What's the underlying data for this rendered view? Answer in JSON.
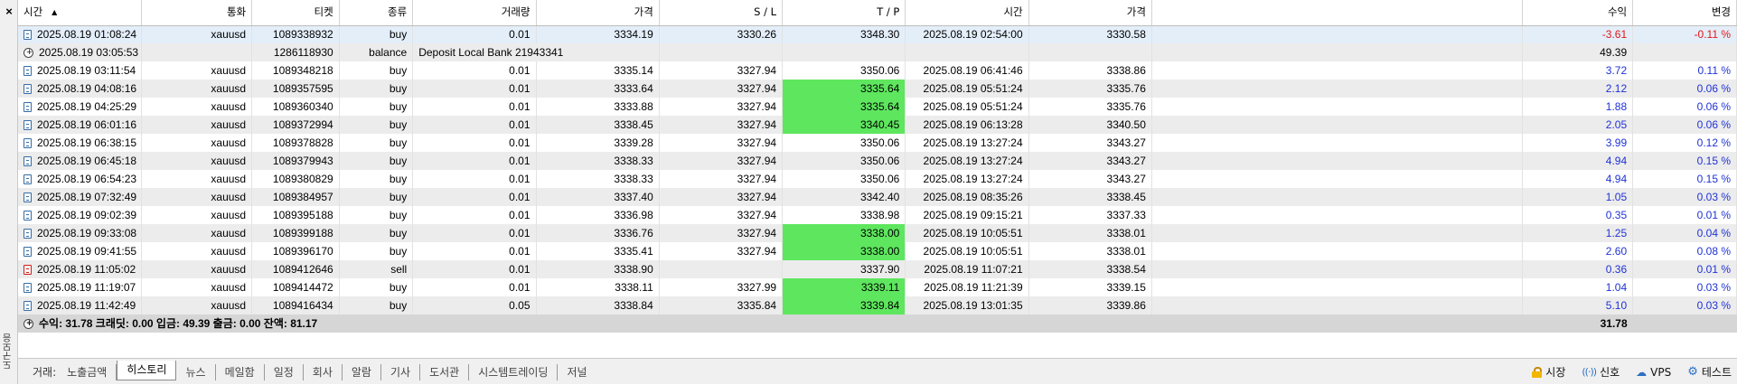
{
  "window": {
    "close_glyph": "×",
    "side_label": "도구모음"
  },
  "columns": [
    "시간",
    "통화",
    "티켓",
    "종류",
    "거래량",
    "가격",
    "S / L",
    "T / P",
    "시간",
    "가격",
    "",
    "수익",
    "변경"
  ],
  "rows": [
    {
      "icon": "buy-order-icon",
      "open_time": "2025.08.19 01:08:24",
      "symbol": "xauusd",
      "ticket": "1089338932",
      "type": "buy",
      "volume": "0.01",
      "price": "3334.19",
      "sl": "3330.26",
      "tp": "3348.30",
      "tp_hit": false,
      "close_time": "2025.08.19 02:54:00",
      "close_price": "3330.58",
      "comment": "",
      "profit": "-3.61",
      "change": "-0.11 %",
      "sign": "neg",
      "selected": true
    },
    {
      "icon": "deposit-icon",
      "open_time": "2025.08.19 03:05:53",
      "symbol": "",
      "ticket": "1286118930",
      "type": "balance",
      "volume": "Deposit Local Bank 21943341",
      "price": "",
      "sl": "",
      "tp": "",
      "tp_hit": false,
      "close_time": "",
      "close_price": "",
      "comment": "",
      "profit": "49.39",
      "change": "",
      "sign": "none",
      "selected": false
    },
    {
      "icon": "buy-order-icon",
      "open_time": "2025.08.19 03:11:54",
      "symbol": "xauusd",
      "ticket": "1089348218",
      "type": "buy",
      "volume": "0.01",
      "price": "3335.14",
      "sl": "3327.94",
      "tp": "3350.06",
      "tp_hit": false,
      "close_time": "2025.08.19 06:41:46",
      "close_price": "3338.86",
      "comment": "",
      "profit": "3.72",
      "change": "0.11 %",
      "sign": "pos",
      "selected": false
    },
    {
      "icon": "buy-order-icon",
      "open_time": "2025.08.19 04:08:16",
      "symbol": "xauusd",
      "ticket": "1089357595",
      "type": "buy",
      "volume": "0.01",
      "price": "3333.64",
      "sl": "3327.94",
      "tp": "3335.64",
      "tp_hit": true,
      "close_time": "2025.08.19 05:51:24",
      "close_price": "3335.76",
      "comment": "",
      "profit": "2.12",
      "change": "0.06 %",
      "sign": "pos",
      "selected": false
    },
    {
      "icon": "buy-order-icon",
      "open_time": "2025.08.19 04:25:29",
      "symbol": "xauusd",
      "ticket": "1089360340",
      "type": "buy",
      "volume": "0.01",
      "price": "3333.88",
      "sl": "3327.94",
      "tp": "3335.64",
      "tp_hit": true,
      "close_time": "2025.08.19 05:51:24",
      "close_price": "3335.76",
      "comment": "",
      "profit": "1.88",
      "change": "0.06 %",
      "sign": "pos",
      "selected": false
    },
    {
      "icon": "buy-order-icon",
      "open_time": "2025.08.19 06:01:16",
      "symbol": "xauusd",
      "ticket": "1089372994",
      "type": "buy",
      "volume": "0.01",
      "price": "3338.45",
      "sl": "3327.94",
      "tp": "3340.45",
      "tp_hit": true,
      "close_time": "2025.08.19 06:13:28",
      "close_price": "3340.50",
      "comment": "",
      "profit": "2.05",
      "change": "0.06 %",
      "sign": "pos",
      "selected": false
    },
    {
      "icon": "buy-order-icon",
      "open_time": "2025.08.19 06:38:15",
      "symbol": "xauusd",
      "ticket": "1089378828",
      "type": "buy",
      "volume": "0.01",
      "price": "3339.28",
      "sl": "3327.94",
      "tp": "3350.06",
      "tp_hit": false,
      "close_time": "2025.08.19 13:27:24",
      "close_price": "3343.27",
      "comment": "",
      "profit": "3.99",
      "change": "0.12 %",
      "sign": "pos",
      "selected": false
    },
    {
      "icon": "buy-order-icon",
      "open_time": "2025.08.19 06:45:18",
      "symbol": "xauusd",
      "ticket": "1089379943",
      "type": "buy",
      "volume": "0.01",
      "price": "3338.33",
      "sl": "3327.94",
      "tp": "3350.06",
      "tp_hit": false,
      "close_time": "2025.08.19 13:27:24",
      "close_price": "3343.27",
      "comment": "",
      "profit": "4.94",
      "change": "0.15 %",
      "sign": "pos",
      "selected": false
    },
    {
      "icon": "buy-order-icon",
      "open_time": "2025.08.19 06:54:23",
      "symbol": "xauusd",
      "ticket": "1089380829",
      "type": "buy",
      "volume": "0.01",
      "price": "3338.33",
      "sl": "3327.94",
      "tp": "3350.06",
      "tp_hit": false,
      "close_time": "2025.08.19 13:27:24",
      "close_price": "3343.27",
      "comment": "",
      "profit": "4.94",
      "change": "0.15 %",
      "sign": "pos",
      "selected": false
    },
    {
      "icon": "buy-order-icon",
      "open_time": "2025.08.19 07:32:49",
      "symbol": "xauusd",
      "ticket": "1089384957",
      "type": "buy",
      "volume": "0.01",
      "price": "3337.40",
      "sl": "3327.94",
      "tp": "3342.40",
      "tp_hit": false,
      "close_time": "2025.08.19 08:35:26",
      "close_price": "3338.45",
      "comment": "",
      "profit": "1.05",
      "change": "0.03 %",
      "sign": "pos",
      "selected": false
    },
    {
      "icon": "buy-order-icon",
      "open_time": "2025.08.19 09:02:39",
      "symbol": "xauusd",
      "ticket": "1089395188",
      "type": "buy",
      "volume": "0.01",
      "price": "3336.98",
      "sl": "3327.94",
      "tp": "3338.98",
      "tp_hit": false,
      "close_time": "2025.08.19 09:15:21",
      "close_price": "3337.33",
      "comment": "",
      "profit": "0.35",
      "change": "0.01 %",
      "sign": "pos",
      "selected": false
    },
    {
      "icon": "buy-order-icon",
      "open_time": "2025.08.19 09:33:08",
      "symbol": "xauusd",
      "ticket": "1089399188",
      "type": "buy",
      "volume": "0.01",
      "price": "3336.76",
      "sl": "3327.94",
      "tp": "3338.00",
      "tp_hit": true,
      "close_time": "2025.08.19 10:05:51",
      "close_price": "3338.01",
      "comment": "",
      "profit": "1.25",
      "change": "0.04 %",
      "sign": "pos",
      "selected": false
    },
    {
      "icon": "buy-order-icon",
      "open_time": "2025.08.19 09:41:55",
      "symbol": "xauusd",
      "ticket": "1089396170",
      "type": "buy",
      "volume": "0.01",
      "price": "3335.41",
      "sl": "3327.94",
      "tp": "3338.00",
      "tp_hit": true,
      "close_time": "2025.08.19 10:05:51",
      "close_price": "3338.01",
      "comment": "",
      "profit": "2.60",
      "change": "0.08 %",
      "sign": "pos",
      "selected": false
    },
    {
      "icon": "sell-order-icon",
      "open_time": "2025.08.19 11:05:02",
      "symbol": "xauusd",
      "ticket": "1089412646",
      "type": "sell",
      "volume": "0.01",
      "price": "3338.90",
      "sl": "",
      "tp": "3337.90",
      "tp_hit": false,
      "close_time": "2025.08.19 11:07:21",
      "close_price": "3338.54",
      "comment": "",
      "profit": "0.36",
      "change": "0.01 %",
      "sign": "pos",
      "selected": false
    },
    {
      "icon": "buy-order-icon",
      "open_time": "2025.08.19 11:19:07",
      "symbol": "xauusd",
      "ticket": "1089414472",
      "type": "buy",
      "volume": "0.01",
      "price": "3338.11",
      "sl": "3327.99",
      "tp": "3339.11",
      "tp_hit": true,
      "close_time": "2025.08.19 11:21:39",
      "close_price": "3339.15",
      "comment": "",
      "profit": "1.04",
      "change": "0.03 %",
      "sign": "pos",
      "selected": false
    },
    {
      "icon": "buy-order-icon",
      "open_time": "2025.08.19 11:42:49",
      "symbol": "xauusd",
      "ticket": "1089416434",
      "type": "buy",
      "volume": "0.05",
      "price": "3338.84",
      "sl": "3335.84",
      "tp": "3339.84",
      "tp_hit": true,
      "close_time": "2025.08.19 13:01:35",
      "close_price": "3339.86",
      "comment": "",
      "profit": "5.10",
      "change": "0.03 %",
      "sign": "pos",
      "selected": false
    }
  ],
  "summary": {
    "text": "수익: 31.78  크래딧: 0.00  입금: 49.39  출금: 0.00  잔액: 81.17",
    "total_profit": "31.78"
  },
  "tabs": [
    {
      "name": "tab-trade",
      "label": "거래:"
    },
    {
      "name": "tab-exposure",
      "label": "노출금액"
    },
    {
      "name": "tab-history",
      "label": "히스토리",
      "active": true
    },
    {
      "name": "tab-news",
      "label": "뉴스"
    },
    {
      "name": "tab-mailbox",
      "label": "메일함"
    },
    {
      "name": "tab-calendar",
      "label": "일정"
    },
    {
      "name": "tab-company",
      "label": "회사"
    },
    {
      "name": "tab-alerts",
      "label": "알람"
    },
    {
      "name": "tab-articles",
      "label": "기사"
    },
    {
      "name": "tab-library",
      "label": "도서관"
    },
    {
      "name": "tab-system-trading",
      "label": "시스템트레이딩"
    },
    {
      "name": "tab-journal",
      "label": "저널"
    }
  ],
  "status": {
    "market": "시장",
    "signals": "신호",
    "vps": "VPS",
    "tester": "테스트"
  },
  "colors": {
    "tp_hit_bg": "#5ee65e",
    "profit_positive": "#1f32d6",
    "profit_negative": "#e01919",
    "selected_row": "#e3eef9",
    "summary_row": "#d6d6d6"
  }
}
